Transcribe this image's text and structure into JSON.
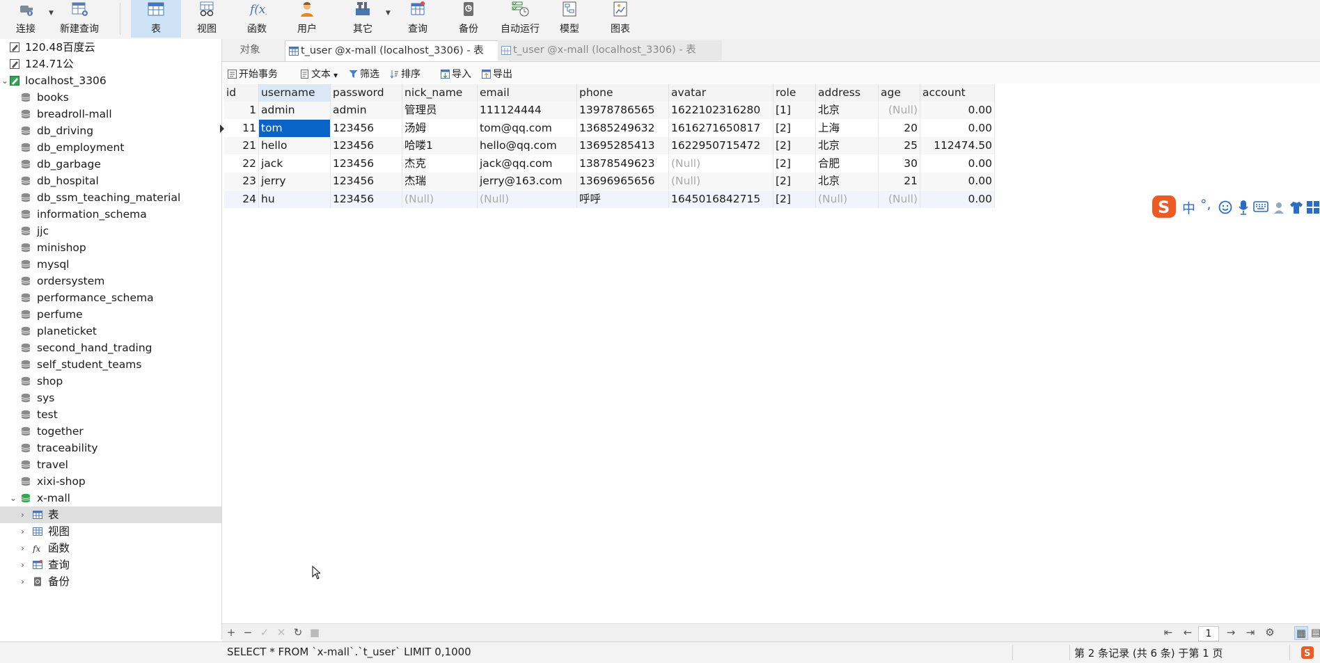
{
  "toolbar": {
    "buttons": [
      {
        "label": "连接",
        "icon": "plug-icon"
      },
      {
        "label": "新建查询",
        "icon": "new-query-icon"
      },
      {
        "label": "表",
        "icon": "table-icon"
      },
      {
        "label": "视图",
        "icon": "view-icon"
      },
      {
        "label": "函数",
        "icon": "function-icon"
      },
      {
        "label": "用户",
        "icon": "user-icon"
      },
      {
        "label": "其它",
        "icon": "tools-icon"
      },
      {
        "label": "查询",
        "icon": "query-icon"
      },
      {
        "label": "备份",
        "icon": "backup-icon"
      },
      {
        "label": "自动运行",
        "icon": "schedule-icon"
      },
      {
        "label": "模型",
        "icon": "model-icon"
      },
      {
        "label": "图表",
        "icon": "chart-icon"
      }
    ],
    "active": "表"
  },
  "sidebar": {
    "connections": [
      {
        "label": "120.48百度云",
        "icon": "connection-icon"
      },
      {
        "label": "124.71公",
        "icon": "connection-icon"
      },
      {
        "label": "localhost_3306",
        "icon": "mysql-connection-icon",
        "expanded": true
      }
    ],
    "databases": [
      "books",
      "breadroll-mall",
      "db_driving",
      "db_employment",
      "db_garbage",
      "db_hospital",
      "db_ssm_teaching_material",
      "information_schema",
      "jjc",
      "minishop",
      "mysql",
      "ordersystem",
      "performance_schema",
      "perfume",
      "planeticket",
      "second_hand_trading",
      "self_student_teams",
      "shop",
      "sys",
      "test",
      "together",
      "traceability",
      "travel",
      "xixi-shop"
    ],
    "open_database": "x-mall",
    "open_children": [
      {
        "label": "表",
        "icon": "table-icon",
        "selected": true
      },
      {
        "label": "视图",
        "icon": "view-icon"
      },
      {
        "label": "函数",
        "icon": "function-icon"
      },
      {
        "label": "查询",
        "icon": "query-icon"
      },
      {
        "label": "备份",
        "icon": "backup-icon"
      }
    ]
  },
  "tabs": {
    "objects_label": "对象",
    "items": [
      {
        "label": "t_user @x-mall (localhost_3306) - 表",
        "active": true
      },
      {
        "label": "t_user @x-mall (localhost_3306) - 表",
        "active": false
      }
    ]
  },
  "actions": [
    {
      "label": "开始事务",
      "icon": "transaction-icon"
    },
    {
      "label": "文本",
      "icon": "text-icon"
    },
    {
      "label": "筛选",
      "icon": "filter-icon"
    },
    {
      "label": "排序",
      "icon": "sort-icon"
    },
    {
      "label": "导入",
      "icon": "import-icon"
    },
    {
      "label": "导出",
      "icon": "export-icon"
    }
  ],
  "table": {
    "columns": [
      "id",
      "username",
      "password",
      "nick_name",
      "email",
      "phone",
      "avatar",
      "role",
      "address",
      "age",
      "account"
    ],
    "selected_column": "username",
    "rows": [
      [
        "1",
        "admin",
        "admin",
        "管理员",
        "111124444",
        "13978786565",
        "1622102316280",
        "[1]",
        "北京",
        "(Null)",
        "0.00"
      ],
      [
        "11",
        "tom",
        "123456",
        "汤姆",
        "tom@qq.com",
        "13685249632",
        "1616271650817",
        "[2]",
        "上海",
        "20",
        "0.00"
      ],
      [
        "21",
        "hello",
        "123456",
        "哈喽1",
        "hello@qq.com",
        "13695285413",
        "1622950715472",
        "[2]",
        "北京",
        "25",
        "112474.50"
      ],
      [
        "22",
        "jack",
        "123456",
        "杰克",
        "jack@qq.com",
        "13878549623",
        "(Null)",
        "[2]",
        "合肥",
        "30",
        "0.00"
      ],
      [
        "23",
        "jerry",
        "123456",
        "杰瑞",
        "jerry@163.com",
        "13696965656",
        "(Null)",
        "[2]",
        "北京",
        "21",
        "0.00"
      ],
      [
        "24",
        "hu",
        "123456",
        "(Null)",
        "(Null)",
        "呼呼",
        "1645016842715",
        "[2]",
        "(Null)",
        "(Null)",
        "0.00"
      ]
    ],
    "current_row": 1,
    "selected_cell": "tom"
  },
  "bottom": {
    "page_number": "1"
  },
  "status": {
    "sql": "SELECT * FROM `x-mall`.`t_user` LIMIT 0,1000",
    "record_info": "第 2 条记录 (共 6 条) 于第 1 页"
  },
  "ime": {
    "logo": "S",
    "mode": "中",
    "punct": "°,"
  }
}
